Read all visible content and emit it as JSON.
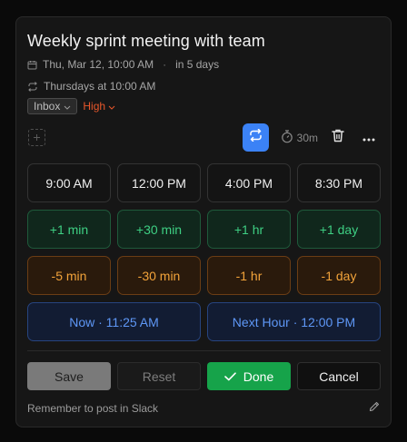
{
  "task": {
    "title": "Weekly sprint meeting with team",
    "date": "Thu, Mar 12, 10:00 AM",
    "separator": "·",
    "relative": "in 5 days",
    "recurrence": "Thursdays at 10:00 AM"
  },
  "chips": {
    "inbox": "Inbox",
    "priority": "High"
  },
  "toolbar": {
    "duration": "30m",
    "icons": [
      "add-icon",
      "repeat-icon",
      "stopwatch-icon",
      "trash-icon",
      "more-icon"
    ]
  },
  "times": [
    "9:00 AM",
    "12:00 PM",
    "4:00 PM",
    "8:30 PM"
  ],
  "plus": [
    "+1 min",
    "+30 min",
    "+1 hr",
    "+1 day"
  ],
  "minus": [
    "-5 min",
    "-30 min",
    "-1 hr",
    "-1 day"
  ],
  "quick": {
    "now": "Now · 11:25 AM",
    "next_hour": "Next Hour · 12:00 PM"
  },
  "actions": {
    "save": "Save",
    "reset": "Reset",
    "done": "Done",
    "cancel": "Cancel"
  },
  "note": "Remember to post in Slack",
  "colors": {
    "accent_blue": "#3b82f6",
    "priority_high": "#e8572b",
    "done_green": "#16a34a",
    "plus_green": "#3ecf83",
    "minus_orange": "#f2a33a"
  }
}
